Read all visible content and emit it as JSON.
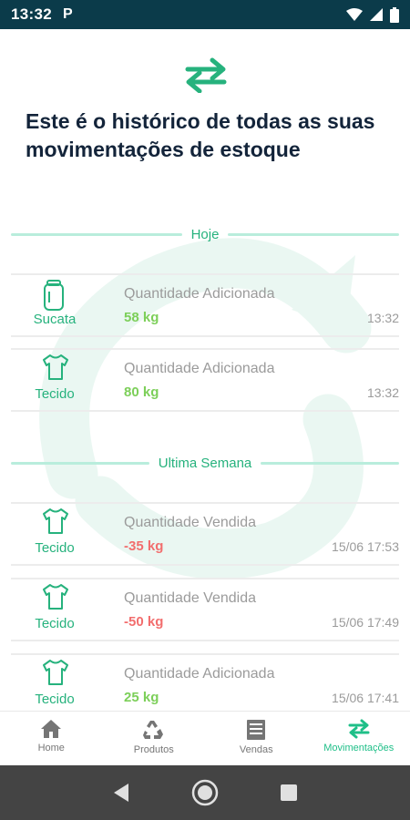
{
  "status_bar": {
    "time": "13:32",
    "notification_glyph": "P"
  },
  "header": {
    "title": "Este é o histórico de todas as suas movimentações de estoque"
  },
  "sections": [
    {
      "label": "Hoje",
      "entries": [
        {
          "category": "Sucata",
          "icon": "can-icon",
          "operation": "Quantidade Adicionada",
          "quantity": "58 kg",
          "time": "13:32"
        },
        {
          "category": "Tecido",
          "icon": "shirt-icon",
          "operation": "Quantidade Adicionada",
          "quantity": "80 kg",
          "time": "13:32"
        }
      ]
    },
    {
      "label": "Ultima Semana",
      "entries": [
        {
          "category": "Tecido",
          "icon": "shirt-icon",
          "operation": "Quantidade Vendida",
          "quantity": "-35 kg",
          "time": "15/06 17:53"
        },
        {
          "category": "Tecido",
          "icon": "shirt-icon",
          "operation": "Quantidade Vendida",
          "quantity": "-50 kg",
          "time": "15/06 17:49"
        },
        {
          "category": "Tecido",
          "icon": "shirt-icon",
          "operation": "Quantidade Adicionada",
          "quantity": "25 kg",
          "time": "15/06 17:41"
        }
      ]
    }
  ],
  "bottom_nav": [
    {
      "label": "Home",
      "icon": "home-icon",
      "active": false
    },
    {
      "label": "Produtos",
      "icon": "recycle-icon",
      "active": false
    },
    {
      "label": "Vendas",
      "icon": "receipt-icon",
      "active": false
    },
    {
      "label": "Movimentações",
      "icon": "swap-arrows-icon",
      "active": true
    }
  ],
  "colors": {
    "accent": "#26b27d",
    "positive": "#7ccf59",
    "negative": "#f26e6e",
    "status_bar": "#0b3b4a"
  }
}
